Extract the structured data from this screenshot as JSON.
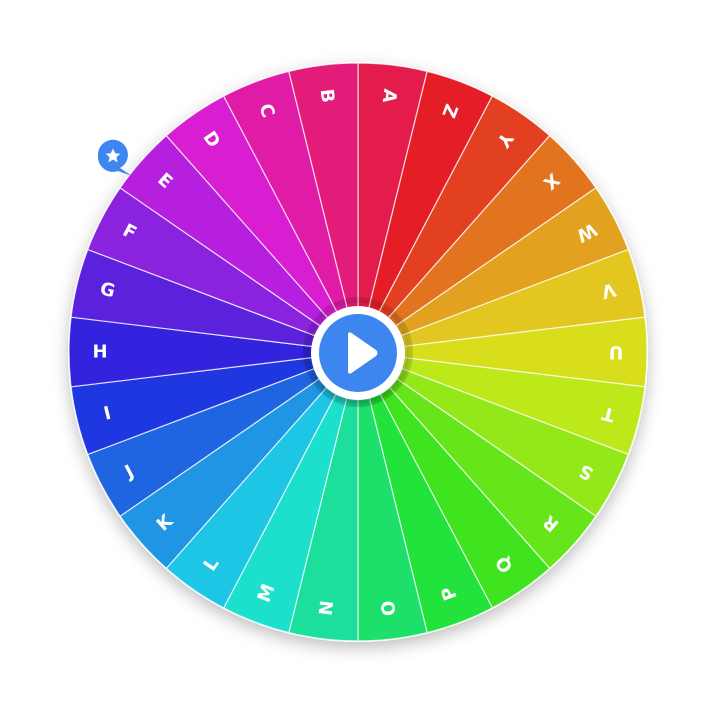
{
  "wheel": {
    "segments": [
      {
        "label": "A",
        "color": "#e41c4b"
      },
      {
        "label": "Z",
        "color": "#e51d26"
      },
      {
        "label": "Y",
        "color": "#e34022"
      },
      {
        "label": "X",
        "color": "#e2741f"
      },
      {
        "label": "W",
        "color": "#e2a220"
      },
      {
        "label": "V",
        "color": "#e3c61f"
      },
      {
        "label": "U",
        "color": "#d9de1c"
      },
      {
        "label": "T",
        "color": "#bde81a"
      },
      {
        "label": "S",
        "color": "#94e81a"
      },
      {
        "label": "R",
        "color": "#67e51b"
      },
      {
        "label": "Q",
        "color": "#3fe41e"
      },
      {
        "label": "P",
        "color": "#22e33b"
      },
      {
        "label": "O",
        "color": "#1de06a"
      },
      {
        "label": "N",
        "color": "#1ddf9c"
      },
      {
        "label": "M",
        "color": "#1de0cc"
      },
      {
        "label": "L",
        "color": "#1ec6e6"
      },
      {
        "label": "K",
        "color": "#1f95e3"
      },
      {
        "label": "J",
        "color": "#1f64e0"
      },
      {
        "label": "I",
        "color": "#1f37e0"
      },
      {
        "label": "H",
        "color": "#3322de"
      },
      {
        "label": "G",
        "color": "#5b22de"
      },
      {
        "label": "F",
        "color": "#8a22de"
      },
      {
        "label": "E",
        "color": "#b61fde"
      },
      {
        "label": "D",
        "color": "#d91dd0"
      },
      {
        "label": "C",
        "color": "#e01ca6"
      },
      {
        "label": "B",
        "color": "#e21c78"
      }
    ]
  },
  "spin_button": {
    "icon": "play-icon",
    "color": "#3d86f0"
  },
  "marker": {
    "icon": "star-pin-icon",
    "color": "#3d86f0"
  }
}
